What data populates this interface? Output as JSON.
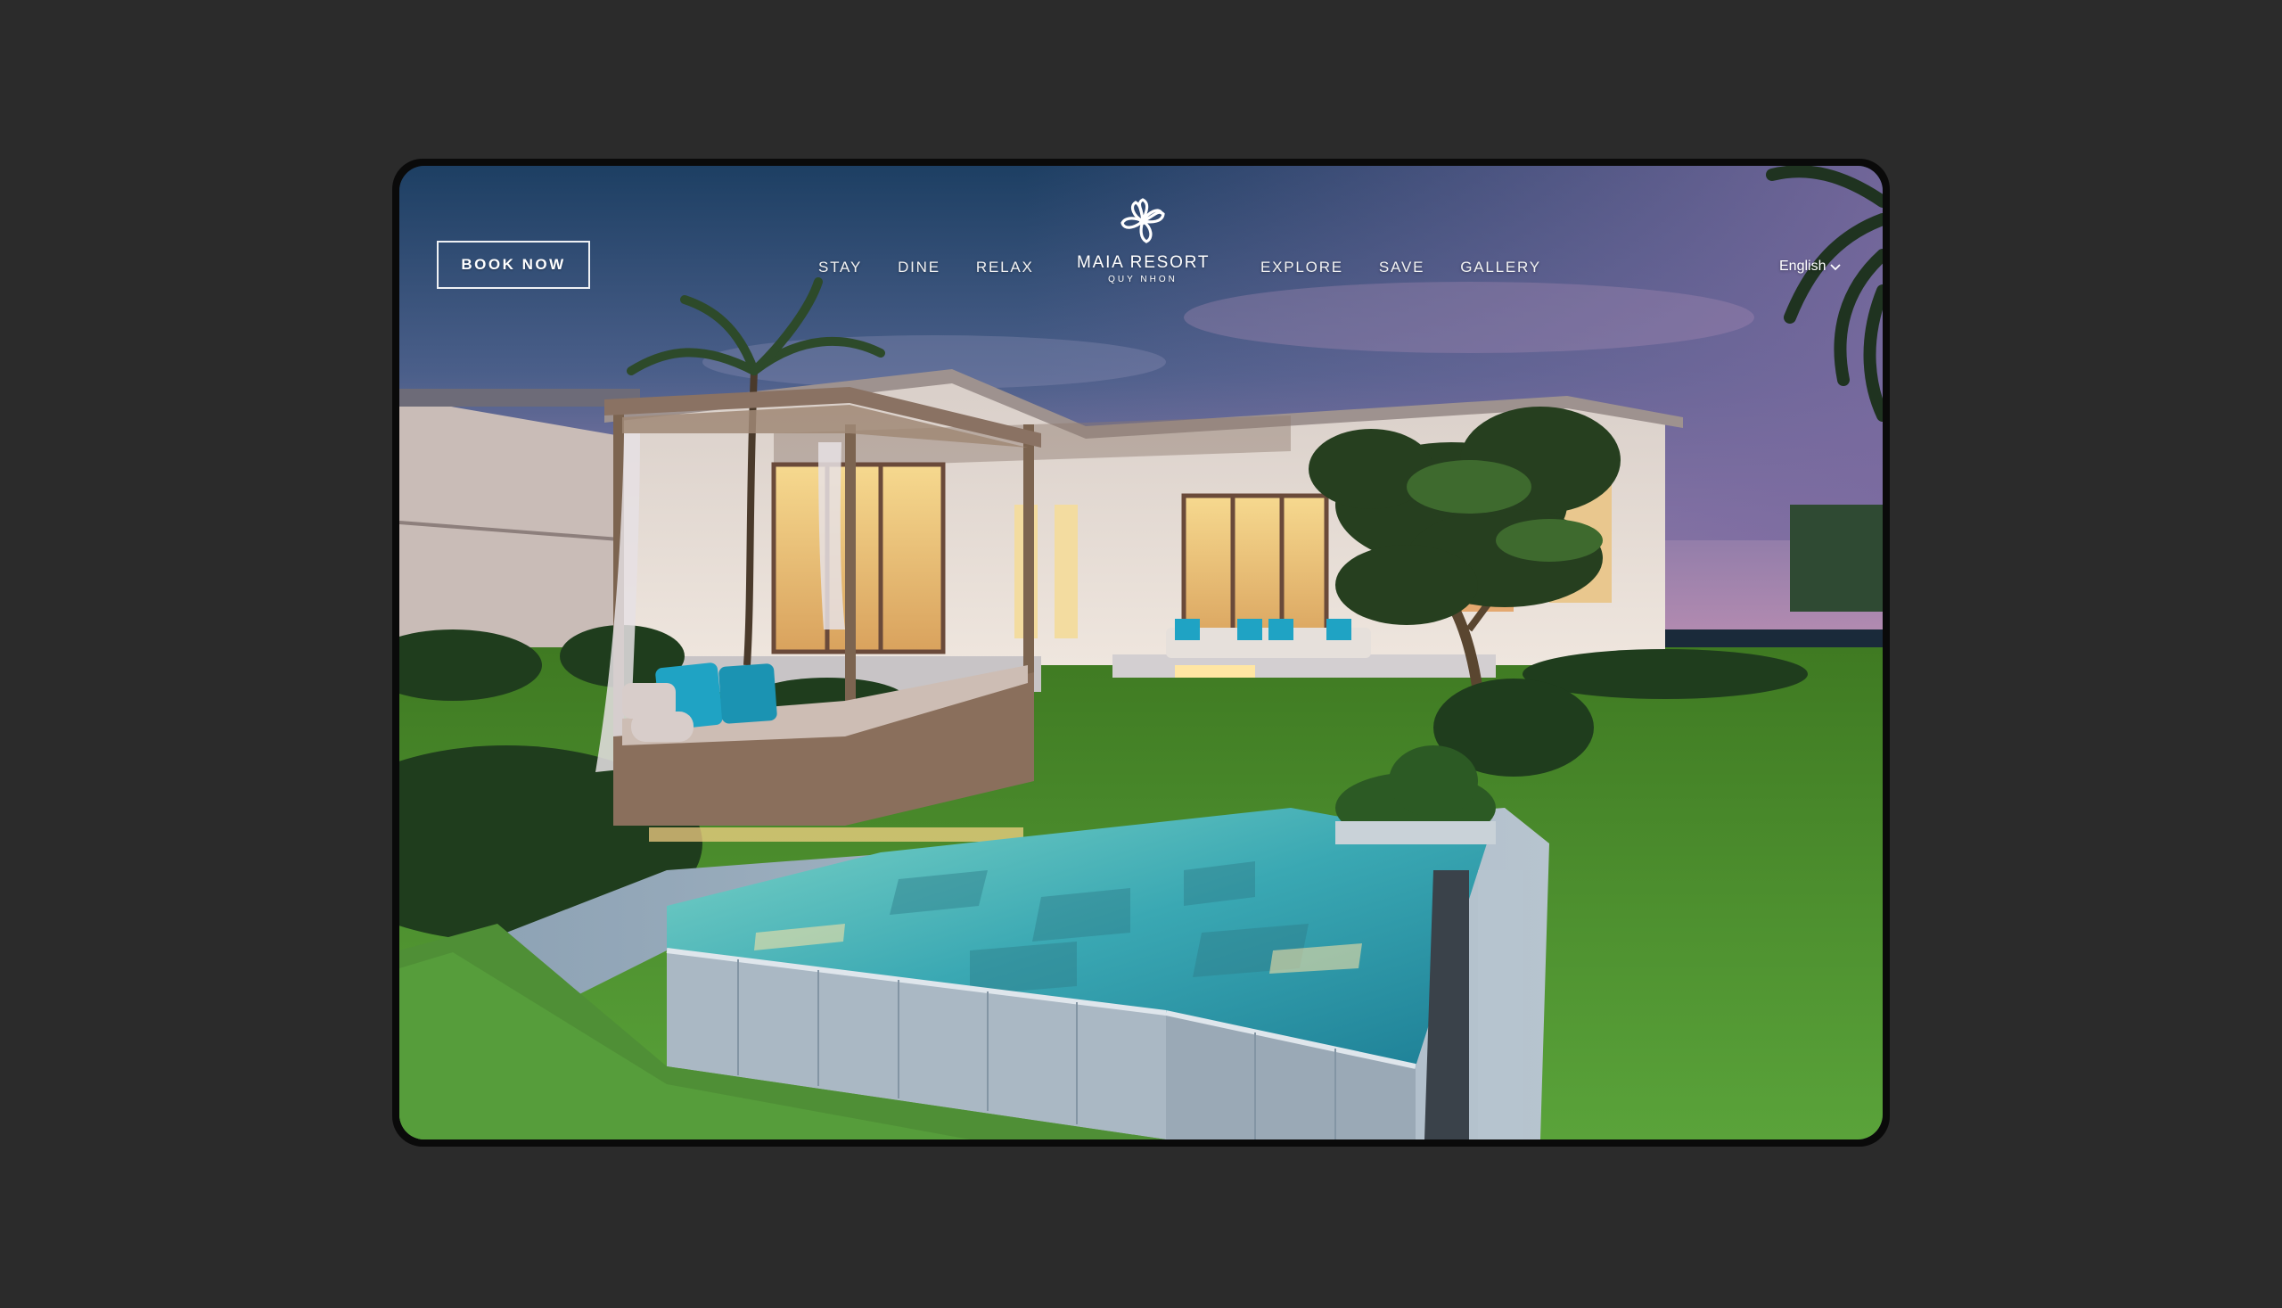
{
  "nav": {
    "book_label": "BOOK NOW",
    "left_items": [
      "STAY",
      "DINE",
      "RELAX"
    ],
    "right_items": [
      "EXPLORE",
      "SAVE",
      "GALLERY"
    ],
    "language": "English"
  },
  "brand": {
    "name": "MAIA RESORT",
    "location": "QUY NHON"
  },
  "hero": {
    "image": "resort-villa-private-pool-at-dusk"
  },
  "colors": {
    "page_background": "#2b2b2b",
    "frame": "#0a0a0a",
    "accent_cushion": "#1fa3c4",
    "pool_water": "#3fb7b8",
    "lawn": "#3f8a2a"
  }
}
